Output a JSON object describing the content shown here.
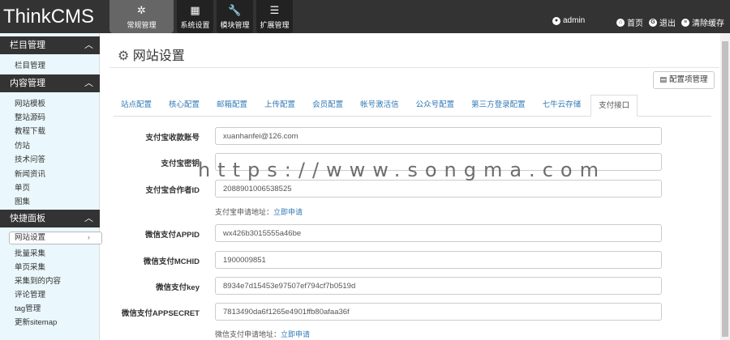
{
  "app": {
    "logo": "ThinkCMS"
  },
  "topnav": [
    {
      "label": "常规管理",
      "icon": "sun-icon"
    },
    {
      "label": "系统设置",
      "icon": "grid-icon"
    },
    {
      "label": "模块管理",
      "icon": "wrench-icon"
    },
    {
      "label": "扩展管理",
      "icon": "list-icon"
    }
  ],
  "user": {
    "name": "admin",
    "home": "首页",
    "logout": "退出",
    "clear_cache": "清除缓存"
  },
  "sidebar": {
    "sections": [
      {
        "title": "栏目管理",
        "items": [
          "栏目管理"
        ]
      },
      {
        "title": "内容管理",
        "items": [
          "网站模板",
          "整站源码",
          "教程下载",
          "仿站",
          "技术问答",
          "新闻资讯",
          "单页",
          "图集"
        ]
      },
      {
        "title": "快捷面板",
        "items": [
          "网站设置",
          "批量采集",
          "单页采集",
          "采集到的内容",
          "评论管理",
          "tag管理",
          "更新sitemap"
        ]
      }
    ]
  },
  "main": {
    "title": "网站设置",
    "config_button": "配置项管理",
    "tabs": [
      "站点配置",
      "核心配置",
      "邮箱配置",
      "上传配置",
      "会员配置",
      "帐号激活信",
      "公众号配置",
      "第三方登录配置",
      "七牛云存储",
      "支付接口"
    ],
    "active_tab": "支付接口",
    "fields": [
      {
        "label": "支付宝收款账号",
        "value": "xuanhanfei@126.com"
      },
      {
        "label": "支付宝密钥",
        "value": ""
      },
      {
        "label": "支付宝合作者ID",
        "value": "2088901006538525"
      },
      {
        "label": "微信支付APPID",
        "value": "wx426b3015555a46be"
      },
      {
        "label": "微信支付MCHID",
        "value": "1900009851"
      },
      {
        "label": "微信支付key",
        "value": "8934e7d15453e97507ef794cf7b0519d"
      },
      {
        "label": "微信支付APPSECRET",
        "value": "7813490da6f1265e4901ffb80afaa36f"
      }
    ],
    "alipay_help": {
      "text": "支付宝申请地址：",
      "link": "立即申请"
    },
    "wechat_help": {
      "text": "微信支付申请地址：",
      "link": "立即申请"
    }
  },
  "watermark": "https://www.songma.com"
}
